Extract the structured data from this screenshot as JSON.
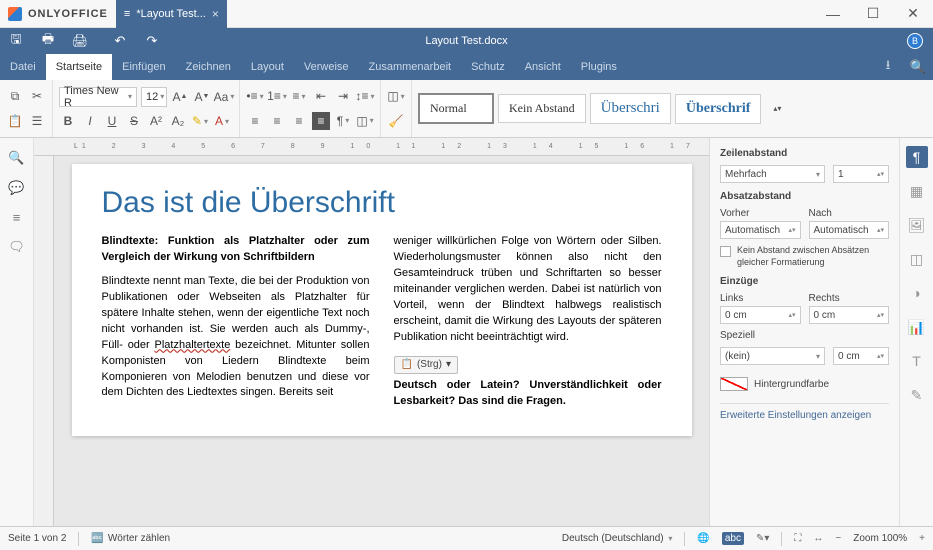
{
  "app": {
    "name": "ONLYOFFICE",
    "tab_label": "*Layout Test...",
    "doc_title": "Layout Test.docx",
    "avatar_letter": "B"
  },
  "menu": {
    "datei": "Datei",
    "startseite": "Startseite",
    "einfuegen": "Einfügen",
    "zeichnen": "Zeichnen",
    "layout": "Layout",
    "verweise": "Verweise",
    "zusammen": "Zusammenarbeit",
    "schutz": "Schutz",
    "ansicht": "Ansicht",
    "plugins": "Plugins"
  },
  "ribbon": {
    "font_name": "Times New R",
    "font_size": "12"
  },
  "styles": {
    "normal": "Normal",
    "no_spacing": "Kein Abstand",
    "heading1": "Überschri",
    "heading2": "Überschrif"
  },
  "rightpanel": {
    "line_spacing_hdr": "Zeilenabstand",
    "line_spacing_mode": "Mehrfach",
    "line_spacing_val": "1",
    "para_spacing_hdr": "Absatzabstand",
    "before_lbl": "Vorher",
    "after_lbl": "Nach",
    "before_val": "Automatisch",
    "after_val": "Automatisch",
    "no_space_same": "Kein Abstand zwischen Absätzen gleicher Formatierung",
    "indent_hdr": "Einzüge",
    "left_lbl": "Links",
    "right_lbl": "Rechts",
    "left_val": "0 cm",
    "right_val": "0 cm",
    "special_lbl": "Speziell",
    "special_mode": "(kein)",
    "special_val": "0 cm",
    "bg_lbl": "Hintergrundfarbe",
    "adv_link": "Erweiterte Einstellungen anzeigen"
  },
  "doc": {
    "h1": "Das ist die Überschrift",
    "sub1": "Blindtexte: Funktion als Platzhalter oder zum Vergleich der Wirkung von Schriftbildern",
    "p1a": "Blindtexte nennt man Texte, die bei der Produktion von Publikationen oder Webseiten als Platzhalter für spätere Inhalte stehen, wenn der eigentliche Text noch nicht vorhanden ist. Sie werden auch als Dummy-, Füll- oder ",
    "p1u": "Platzhaltertexte",
    "p1b": " bezeichnet. Mitunter sollen Komponisten von Liedern Blindtexte beim Komponieren von Melodien benutzen und diese vor dem Dichten des Liedtextes singen. Bereits seit",
    "p2": "weniger willkürlichen Folge von Wörtern oder Silben. Wiederholungsmuster können also nicht den Gesamteindruck trüben und Schriftarten so besser miteinander verglichen werden. Dabei ist natürlich von Vorteil, wenn der Blindtext halbwegs realistisch erscheint, damit die Wirkung des Layouts der späteren Publikation nicht beeinträchtigt wird.",
    "tag": "(Strg)",
    "sub2": "Deutsch oder Latein? Unverständlichkeit oder Lesbarkeit? Das sind die Fragen."
  },
  "status": {
    "page": "Seite 1 von 2",
    "wordcount": "Wörter zählen",
    "lang": "Deutsch (Deutschland)",
    "zoom": "Zoom 100%"
  }
}
